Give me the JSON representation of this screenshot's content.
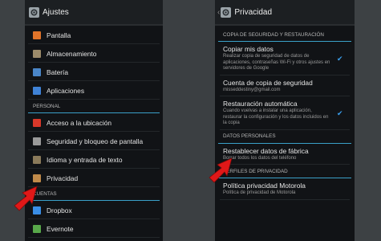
{
  "left_screen": {
    "title": "Ajustes",
    "items_top": [
      {
        "label": "Pantalla",
        "icon": "display-icon",
        "color": "#e0742a"
      },
      {
        "label": "Almacenamiento",
        "icon": "storage-icon",
        "color": "#9c8b6a"
      },
      {
        "label": "Batería",
        "icon": "battery-icon",
        "color": "#4a86c8"
      },
      {
        "label": "Aplicaciones",
        "icon": "apps-icon",
        "color": "#3f82d6"
      }
    ],
    "section_personal": "PERSONAL",
    "items_personal": [
      {
        "label": "Acceso a la ubicación",
        "icon": "location-icon",
        "color": "#d9382a"
      },
      {
        "label": "Seguridad y bloqueo de pantalla",
        "icon": "lock-icon",
        "color": "#9a9a9a"
      },
      {
        "label": "Idioma y entrada de texto",
        "icon": "language-icon",
        "color": "#8a7a5a"
      },
      {
        "label": "Privacidad",
        "icon": "privacy-icon",
        "color": "#c08a4a"
      }
    ],
    "section_cuentas": "CUENTAS",
    "items_cuentas": [
      {
        "label": "Dropbox",
        "icon": "dropbox-icon",
        "color": "#3a8ee6"
      },
      {
        "label": "Evernote",
        "icon": "evernote-icon",
        "color": "#58a84a"
      }
    ]
  },
  "right_screen": {
    "title": "Privacidad",
    "section_backup": "COPIA DE SEGURIDAD Y RESTAURACIÓN",
    "backup_items": [
      {
        "title": "Copiar mis datos",
        "subtitle": "Realizar copia de seguridad de datos de aplicaciones, contraseñas Wi-Fi y otros ajustes en servidores de Google",
        "checked": true
      },
      {
        "title": "Cuenta de copia de seguridad",
        "subtitle": "misseddestiny@gmail.com",
        "checked": false
      },
      {
        "title": "Restauración automática",
        "subtitle": "Cuando vuelvas a instalar una aplicación, restaurar la configuración y los datos incluidos en la copia",
        "checked": true
      }
    ],
    "section_personal": "DATOS PERSONALES",
    "reset": {
      "title": "Restablecer datos de fábrica",
      "subtitle": "Borrar todos los datos del teléfono"
    },
    "section_perfiles": "PERFILES DE PRIVACIDAD",
    "motorola": {
      "title": "Política privacidad Motorola",
      "subtitle": "Política de privacidad de Motorola"
    }
  },
  "accent_color": "#3aa0c8",
  "arrow_color": "#e01818"
}
